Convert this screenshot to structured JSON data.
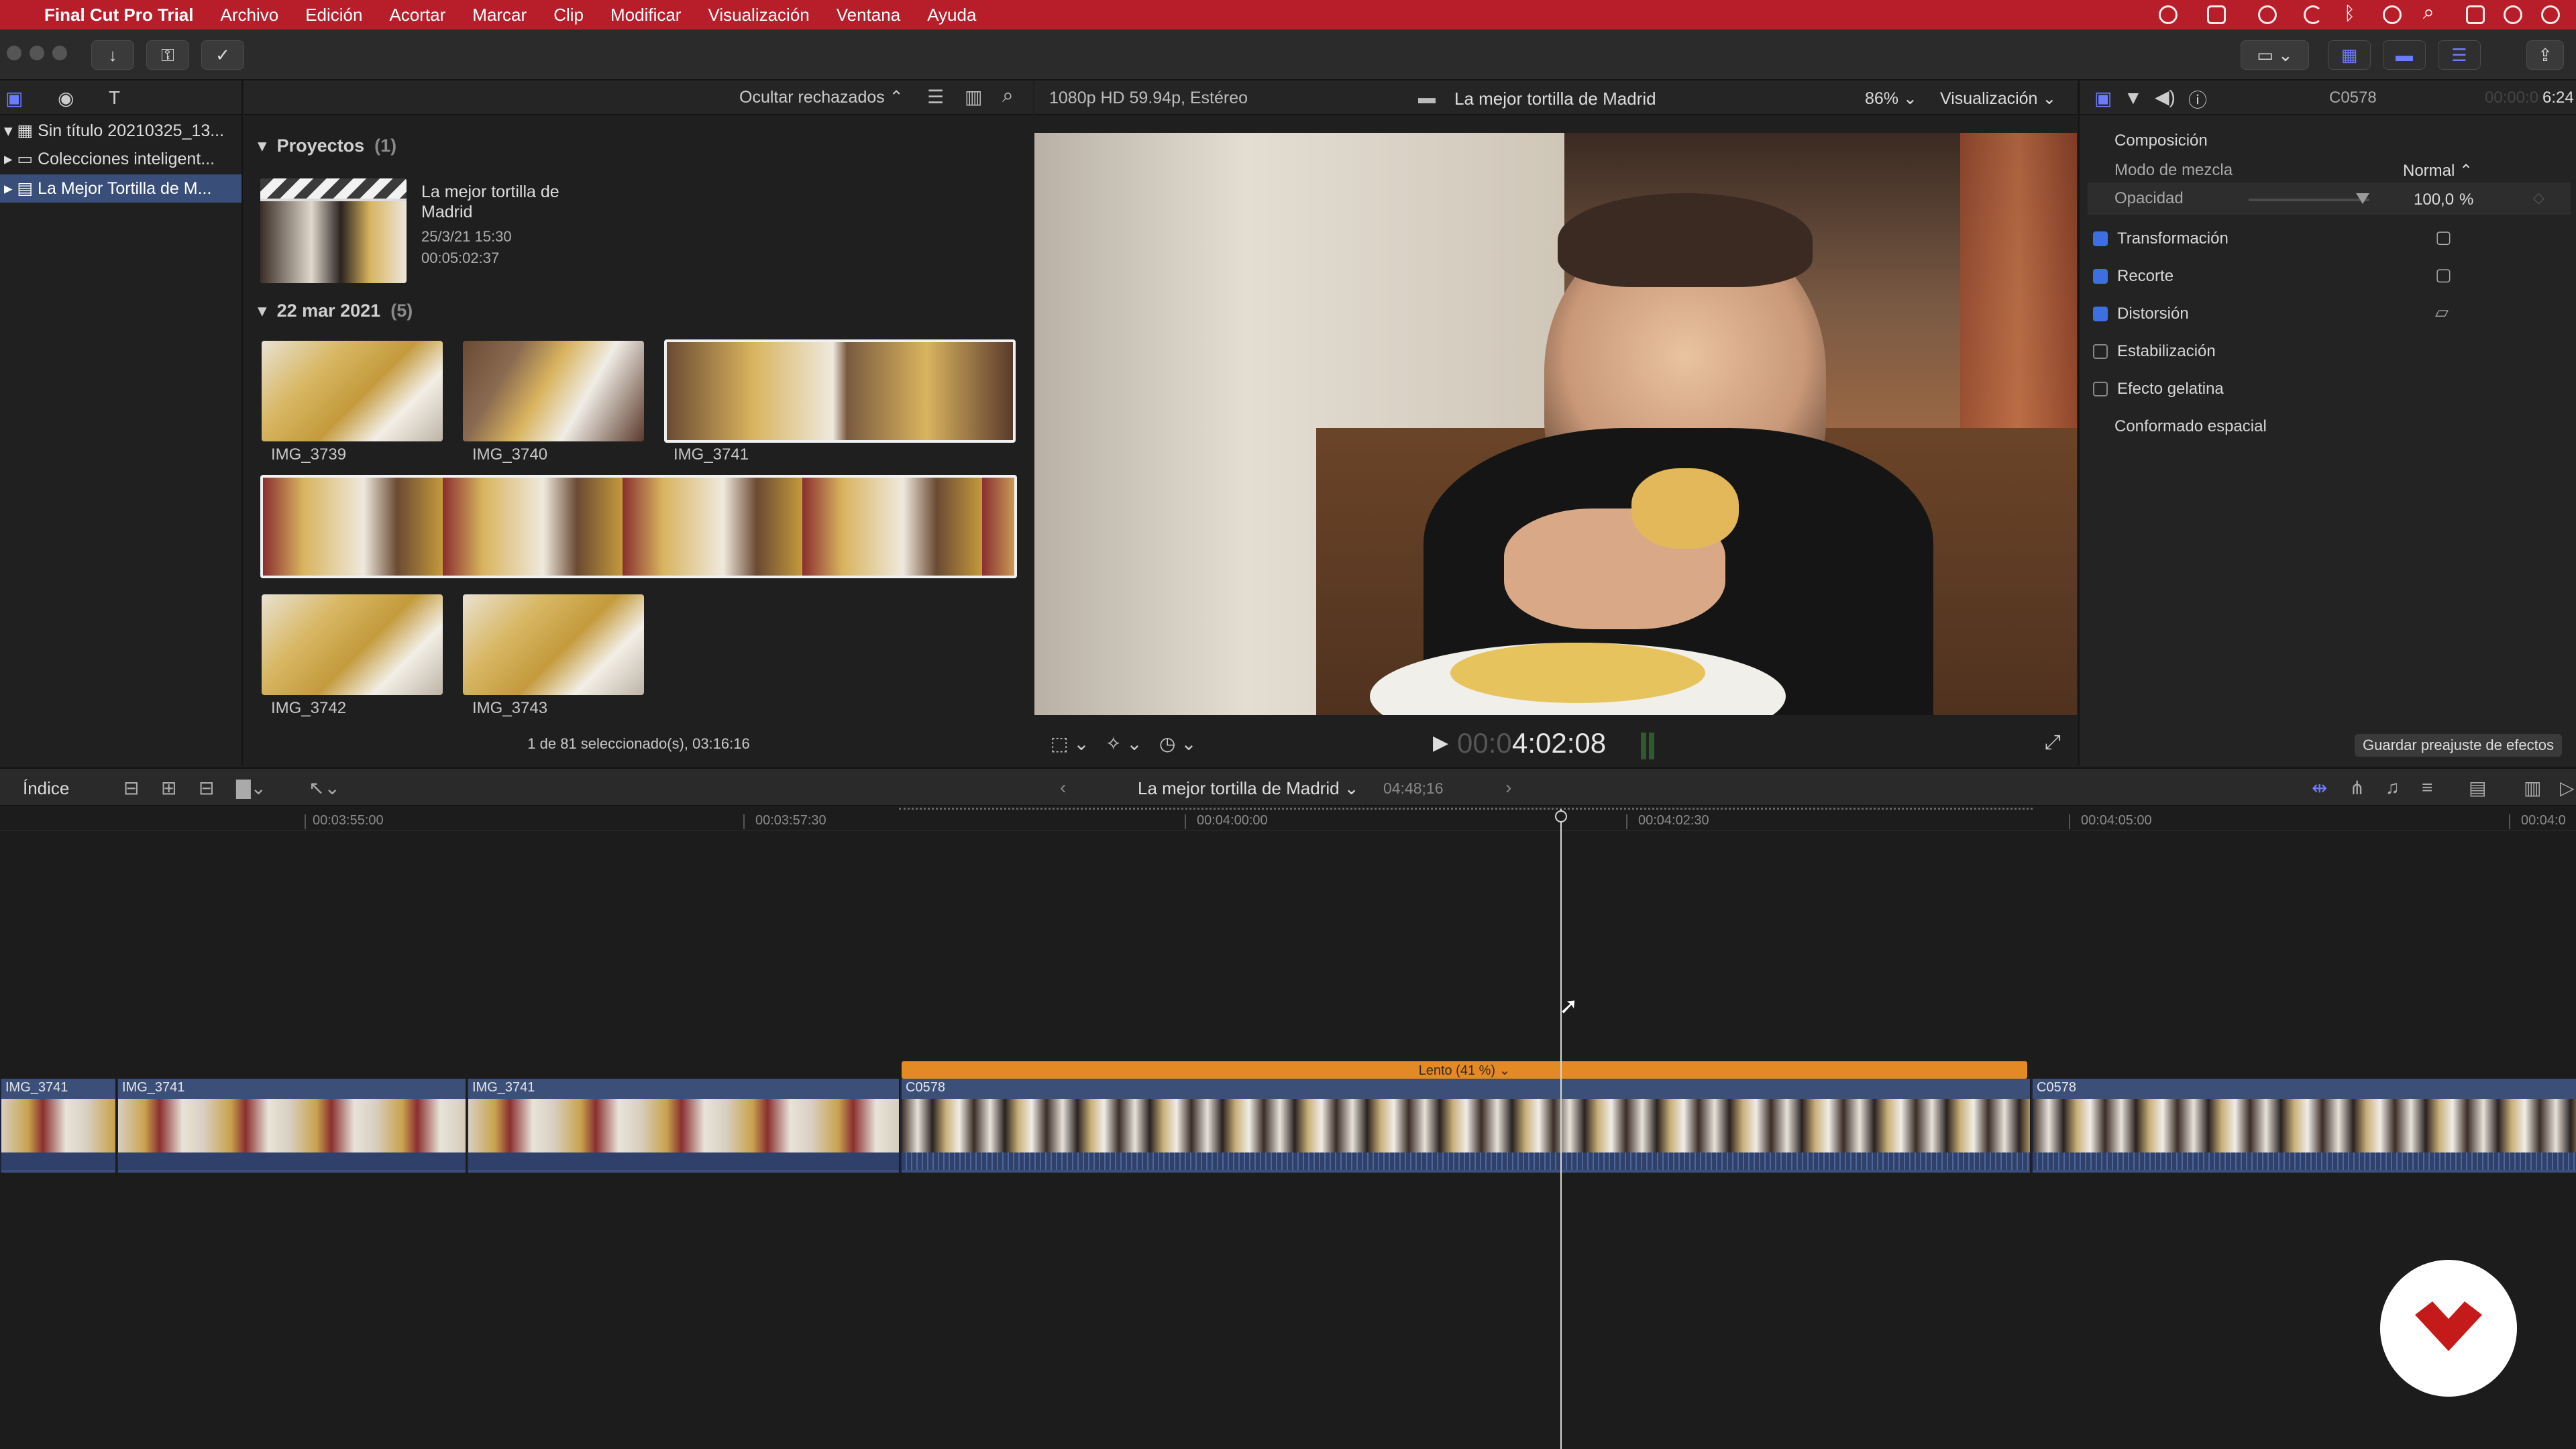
{
  "menubar": {
    "app_name": "Final Cut Pro Trial",
    "items": [
      "Archivo",
      "Edición",
      "Acortar",
      "Marcar",
      "Clip",
      "Modificar",
      "Visualización",
      "Ventana",
      "Ayuda"
    ]
  },
  "library": {
    "items": [
      {
        "label": "Sin título 20210325_13..."
      },
      {
        "label": "Colecciones inteligent..."
      },
      {
        "label": "La Mejor Tortilla de M..."
      }
    ]
  },
  "browser": {
    "filter_label": "Ocultar rechazados",
    "projects_header": "Proyectos",
    "projects_count": "(1)",
    "project": {
      "title_line1": "La mejor tortilla de",
      "title_line2": "Madrid",
      "date": "25/3/21 15:30",
      "duration": "00:05:02:37"
    },
    "date_header": "22 mar 2021",
    "date_count": "(5)",
    "clips": [
      "IMG_3739",
      "IMG_3740",
      "IMG_3741",
      "IMG_3742",
      "IMG_3743"
    ],
    "status": "1 de 81 seleccionado(s), 03:16:16"
  },
  "viewer": {
    "format": "1080p HD 59.94p, Estéreo",
    "title": "La mejor tortilla de Madrid",
    "zoom": "86%",
    "view_menu": "Visualización",
    "timecode_dim": "00:0",
    "timecode": "4:02:08"
  },
  "inspector": {
    "clip_name": "C0578",
    "duration_dim": "00:00:0",
    "duration": "6:24",
    "section": "Composición",
    "blend_label": "Modo de mezcla",
    "blend_value": "Normal",
    "opacity_label": "Opacidad",
    "opacity_value": "100,0",
    "opacity_unit": "%",
    "opacity_level": 1.0,
    "effects": [
      {
        "label": "Transformación",
        "checked": true
      },
      {
        "label": "Recorte",
        "checked": true
      },
      {
        "label": "Distorsión",
        "checked": true
      },
      {
        "label": "Estabilización",
        "checked": false
      },
      {
        "label": "Efecto gelatina",
        "checked": false
      }
    ],
    "spatial": "Conformado espacial",
    "save_preset": "Guardar preajuste de efectos"
  },
  "timeline": {
    "index_label": "Índice",
    "project_title": "La mejor tortilla de Madrid",
    "project_duration": "04:48;16",
    "ruler": [
      "00:03:55:00",
      "00:03:57:30",
      "00:04:00:00",
      "00:04:02:30",
      "00:04:05:00",
      "00:04:0"
    ],
    "retime_label": "Lento (41 %)",
    "clips": [
      "IMG_3741",
      "IMG_3741",
      "IMG_3741",
      "C0578",
      "C0578"
    ]
  },
  "colors": {
    "accent": "#3d6fe0",
    "menubar": "#b81e2a",
    "retime": "#e38a24",
    "clip": "#3b4f79"
  }
}
